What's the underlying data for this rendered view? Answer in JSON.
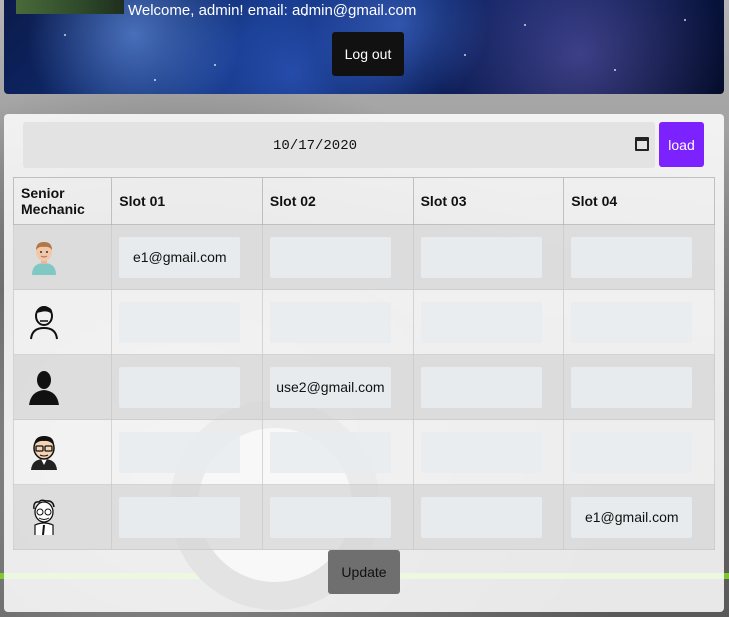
{
  "header": {
    "welcome_text": "Welcome, admin! email: admin@gmail.com",
    "logout_label": "Log out"
  },
  "controls": {
    "date_value": "10/17/2020",
    "load_label": "load",
    "update_label": "Update"
  },
  "table": {
    "headers": [
      "Senior Mechanic",
      "Slot 01",
      "Slot 02",
      "Slot 03",
      "Slot 04"
    ],
    "rows": [
      {
        "icon": "mechanic-avatar-man-icon",
        "slots": [
          "e1@gmail.com",
          "",
          "",
          ""
        ]
      },
      {
        "icon": "mechanic-avatar-outline-icon",
        "slots": [
          "",
          "",
          "",
          ""
        ]
      },
      {
        "icon": "mechanic-avatar-silhouette-icon",
        "slots": [
          "",
          "use2@gmail.com",
          "",
          ""
        ]
      },
      {
        "icon": "mechanic-avatar-glasses-icon",
        "slots": [
          "",
          "",
          "",
          ""
        ]
      },
      {
        "icon": "mechanic-avatar-sketch-icon",
        "slots": [
          "",
          "",
          "",
          "e1@gmail.com"
        ]
      }
    ]
  },
  "colors": {
    "load_button": "#7b22ff",
    "logout_button": "#111111",
    "update_button": "#6f6f6f"
  }
}
